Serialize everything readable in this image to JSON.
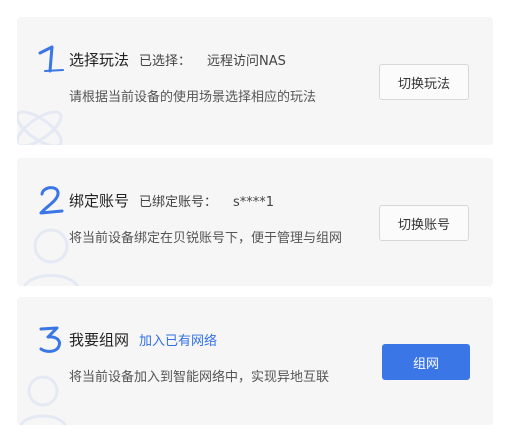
{
  "steps": [
    {
      "number": "1",
      "title": "选择玩法",
      "subtitle": "已选择：",
      "value": "远程访问NAS",
      "description": "请根据当前设备的使用场景选择相应的玩法",
      "button_label": "切换玩法",
      "deco_icon": "orbit-icon"
    },
    {
      "number": "2",
      "title": "绑定账号",
      "subtitle": "已绑定账号：",
      "value": "s****1",
      "description": "将当前设备绑定在贝锐账号下，便于管理与组网",
      "button_label": "切换账号",
      "deco_icon": "user-icon"
    },
    {
      "number": "3",
      "title": "我要组网",
      "link": "加入已有网络",
      "description": "将当前设备加入到智能网络中，实现异地互联",
      "button_label": "组网",
      "deco_icon": "user-icon"
    }
  ],
  "colors": {
    "accent": "#3a76e6",
    "link": "#3370e6",
    "card_bg": "#f6f6f6"
  }
}
